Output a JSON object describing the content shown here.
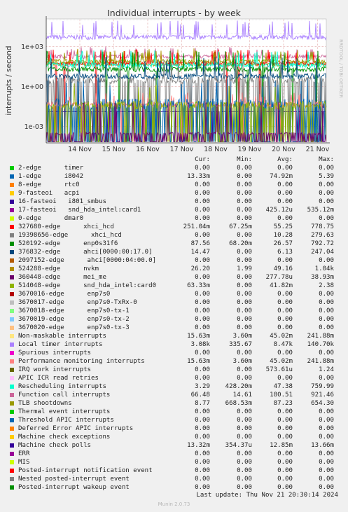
{
  "title": "Individual interrupts - by week",
  "side_text": "RRDTOOL / TOBI OETIKER",
  "munin_version": "Munin 2.0.73",
  "last_update": "Last update: Thu Nov 21 20:30:14 2024",
  "columns": [
    "Cur:",
    "Min:",
    "Avg:",
    "Max:"
  ],
  "chart_data": {
    "type": "line",
    "ylabel": "interrupts / second",
    "yscale": "log",
    "ylim": [
      6e-05,
      120000
    ],
    "y_ticks": [
      "1e-03",
      "1e+00",
      "1e+03"
    ],
    "x_ticks": [
      "14 Nov",
      "15 Nov",
      "16 Nov",
      "17 Nov",
      "18 Nov",
      "19 Nov",
      "20 Nov",
      "21 Nov"
    ],
    "grid": true,
    "legend_position": "bottom",
    "series": [
      {
        "name": "2-edge      timer",
        "color": "#00cc00",
        "cur": "0.00",
        "min": "0.00",
        "avg": "0.00",
        "max": "0.00"
      },
      {
        "name": "1-edge      i8042",
        "color": "#0066b3",
        "cur": "13.33m",
        "min": "0.00",
        "avg": "74.92m",
        "max": "5.39"
      },
      {
        "name": "8-edge      rtc0",
        "color": "#ff8000",
        "cur": "0.00",
        "min": "0.00",
        "avg": "0.00",
        "max": "0.00"
      },
      {
        "name": "9-fasteoi   acpi",
        "color": "#ffcc00",
        "cur": "0.00",
        "min": "0.00",
        "avg": "0.00",
        "max": "0.00"
      },
      {
        "name": "16-fasteoi   i801_smbus",
        "color": "#330099",
        "cur": "0.00",
        "min": "0.00",
        "avg": "0.00",
        "max": "0.00"
      },
      {
        "name": "17-fasteoi   snd_hda_intel:card1",
        "color": "#990099",
        "cur": "0.00",
        "min": "0.00",
        "avg": "425.12u",
        "max": "535.12m"
      },
      {
        "name": "0-edge      dmar0",
        "color": "#ccff00",
        "cur": "0.00",
        "min": "0.00",
        "avg": "0.00",
        "max": "0.00"
      },
      {
        "name": "327680-edge      xhci_hcd",
        "color": "#ff0000",
        "cur": "251.04m",
        "min": "67.25m",
        "avg": "55.25",
        "max": "778.75"
      },
      {
        "name": "19398656-edge      xhci_hcd",
        "color": "#808080",
        "cur": "0.00",
        "min": "0.00",
        "avg": "10.28",
        "max": "279.63"
      },
      {
        "name": "520192-edge      enp0s31f6",
        "color": "#008f00",
        "cur": "87.56",
        "min": "68.20m",
        "avg": "26.57",
        "max": "792.72"
      },
      {
        "name": "376832-edge      ahci[0000:00:17.0]",
        "color": "#00487d",
        "cur": "14.47",
        "min": "0.00",
        "avg": "6.13",
        "max": "247.04"
      },
      {
        "name": "2097152-edge      ahci[0000:04:00.0]",
        "color": "#b35a00",
        "cur": "0.00",
        "min": "0.00",
        "avg": "0.00",
        "max": "0.00"
      },
      {
        "name": "524288-edge      nvkm",
        "color": "#b38f00",
        "cur": "26.20",
        "min": "1.99",
        "avg": "49.16",
        "max": "1.04k"
      },
      {
        "name": "360448-edge      mei_me",
        "color": "#6b006b",
        "cur": "0.00",
        "min": "0.00",
        "avg": "277.78u",
        "max": "38.93m"
      },
      {
        "name": "514048-edge      snd_hda_intel:card0",
        "color": "#8fb300",
        "cur": "63.33m",
        "min": "0.00",
        "avg": "41.82m",
        "max": "2.38"
      },
      {
        "name": "3670016-edge      enp7s0",
        "color": "#b30000",
        "cur": "0.00",
        "min": "0.00",
        "avg": "0.00",
        "max": "0.00"
      },
      {
        "name": "3670017-edge      enp7s0-TxRx-0",
        "color": "#bebebe",
        "cur": "0.00",
        "min": "0.00",
        "avg": "0.00",
        "max": "0.00"
      },
      {
        "name": "3670018-edge      enp7s0-tx-1",
        "color": "#80ff80",
        "cur": "0.00",
        "min": "0.00",
        "avg": "0.00",
        "max": "0.00"
      },
      {
        "name": "3670019-edge      enp7s0-tx-2",
        "color": "#80c9ff",
        "cur": "0.00",
        "min": "0.00",
        "avg": "0.00",
        "max": "0.00"
      },
      {
        "name": "3670020-edge      enp7s0-tx-3",
        "color": "#ffc080",
        "cur": "0.00",
        "min": "0.00",
        "avg": "0.00",
        "max": "0.00"
      },
      {
        "name": "Non-maskable interrupts",
        "color": "#ffe680",
        "cur": "15.63m",
        "min": "3.60m",
        "avg": "45.02m",
        "max": "241.88m"
      },
      {
        "name": "Local timer interrupts",
        "color": "#aa80ff",
        "cur": "3.08k",
        "min": "335.67",
        "avg": "8.47k",
        "max": "140.70k"
      },
      {
        "name": "Spurious interrupts",
        "color": "#ee00cc",
        "cur": "0.00",
        "min": "0.00",
        "avg": "0.00",
        "max": "0.00"
      },
      {
        "name": "Performance monitoring interrupts",
        "color": "#ff8080",
        "cur": "15.63m",
        "min": "3.60m",
        "avg": "45.02m",
        "max": "241.88m"
      },
      {
        "name": "IRQ work interrupts",
        "color": "#666600",
        "cur": "0.00",
        "min": "0.00",
        "avg": "573.61u",
        "max": "1.24"
      },
      {
        "name": "APIC ICR read retries",
        "color": "#ffbfff",
        "cur": "0.00",
        "min": "0.00",
        "avg": "0.00",
        "max": "0.00"
      },
      {
        "name": "Rescheduling interrupts",
        "color": "#00ffcc",
        "cur": "3.29",
        "min": "428.20m",
        "avg": "47.38",
        "max": "759.99"
      },
      {
        "name": "Function call interrupts",
        "color": "#cc6699",
        "cur": "66.48",
        "min": "14.61",
        "avg": "180.51",
        "max": "921.46"
      },
      {
        "name": "TLB shootdowns",
        "color": "#999900",
        "cur": "8.77",
        "min": "668.53m",
        "avg": "87.23",
        "max": "654.30"
      },
      {
        "name": "Thermal event interrupts",
        "color": "#00cc00",
        "cur": "0.00",
        "min": "0.00",
        "avg": "0.00",
        "max": "0.00"
      },
      {
        "name": "Threshold APIC interrupts",
        "color": "#0066b3",
        "cur": "0.00",
        "min": "0.00",
        "avg": "0.00",
        "max": "0.00"
      },
      {
        "name": "Deferred Error APIC interrupts",
        "color": "#ff8000",
        "cur": "0.00",
        "min": "0.00",
        "avg": "0.00",
        "max": "0.00"
      },
      {
        "name": "Machine check exceptions",
        "color": "#ffcc00",
        "cur": "0.00",
        "min": "0.00",
        "avg": "0.00",
        "max": "0.00"
      },
      {
        "name": "Machine check polls",
        "color": "#330099",
        "cur": "13.32m",
        "min": "354.37u",
        "avg": "12.85m",
        "max": "13.66m"
      },
      {
        "name": "ERR",
        "color": "#990099",
        "cur": "0.00",
        "min": "0.00",
        "avg": "0.00",
        "max": "0.00"
      },
      {
        "name": "MIS",
        "color": "#ccff00",
        "cur": "0.00",
        "min": "0.00",
        "avg": "0.00",
        "max": "0.00"
      },
      {
        "name": "Posted-interrupt notification event",
        "color": "#ff0000",
        "cur": "0.00",
        "min": "0.00",
        "avg": "0.00",
        "max": "0.00"
      },
      {
        "name": "Nested posted-interrupt event",
        "color": "#808080",
        "cur": "0.00",
        "min": "0.00",
        "avg": "0.00",
        "max": "0.00"
      },
      {
        "name": "Posted-interrupt wakeup event",
        "color": "#008f00",
        "cur": "0.00",
        "min": "0.00",
        "avg": "0.00",
        "max": "0.00"
      }
    ]
  }
}
